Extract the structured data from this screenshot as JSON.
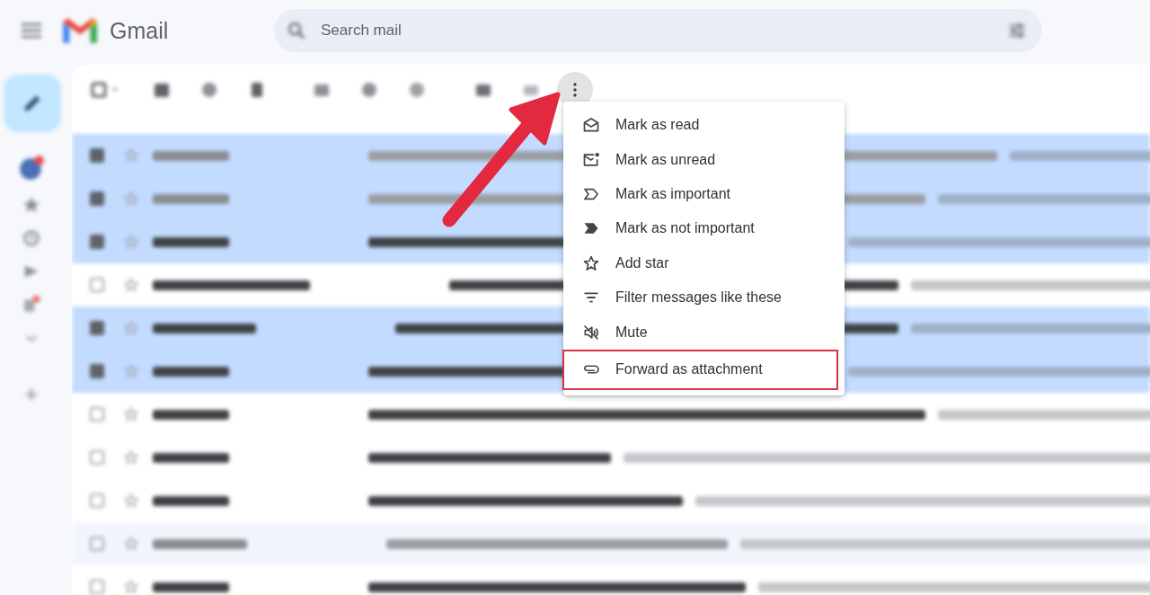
{
  "app": {
    "logo_text": "Gmail"
  },
  "search": {
    "placeholder": "Search mail"
  },
  "toolbar": {
    "more_button": {
      "active": true
    }
  },
  "rows": [
    {
      "selected": true,
      "unread": false
    },
    {
      "selected": true,
      "unread": false
    },
    {
      "selected": true,
      "unread": true
    },
    {
      "selected": false,
      "unread": true
    },
    {
      "selected": true,
      "unread": true
    },
    {
      "selected": true,
      "unread": true
    },
    {
      "selected": false,
      "unread": true
    },
    {
      "selected": false,
      "unread": true
    },
    {
      "selected": false,
      "unread": true
    },
    {
      "selected": false,
      "unread": false
    },
    {
      "selected": false,
      "unread": true
    }
  ],
  "menu": {
    "items": [
      {
        "label": "Mark as read",
        "highlighted": false
      },
      {
        "label": "Mark as unread",
        "highlighted": false
      },
      {
        "label": "Mark as important",
        "highlighted": false
      },
      {
        "label": "Mark as not important",
        "highlighted": false
      },
      {
        "label": "Add star",
        "highlighted": false
      },
      {
        "label": "Filter messages like these",
        "highlighted": false
      },
      {
        "label": "Mute",
        "highlighted": false
      },
      {
        "label": "Forward as attachment",
        "highlighted": true
      }
    ]
  },
  "annotation": {
    "pointer_arrow": true
  }
}
